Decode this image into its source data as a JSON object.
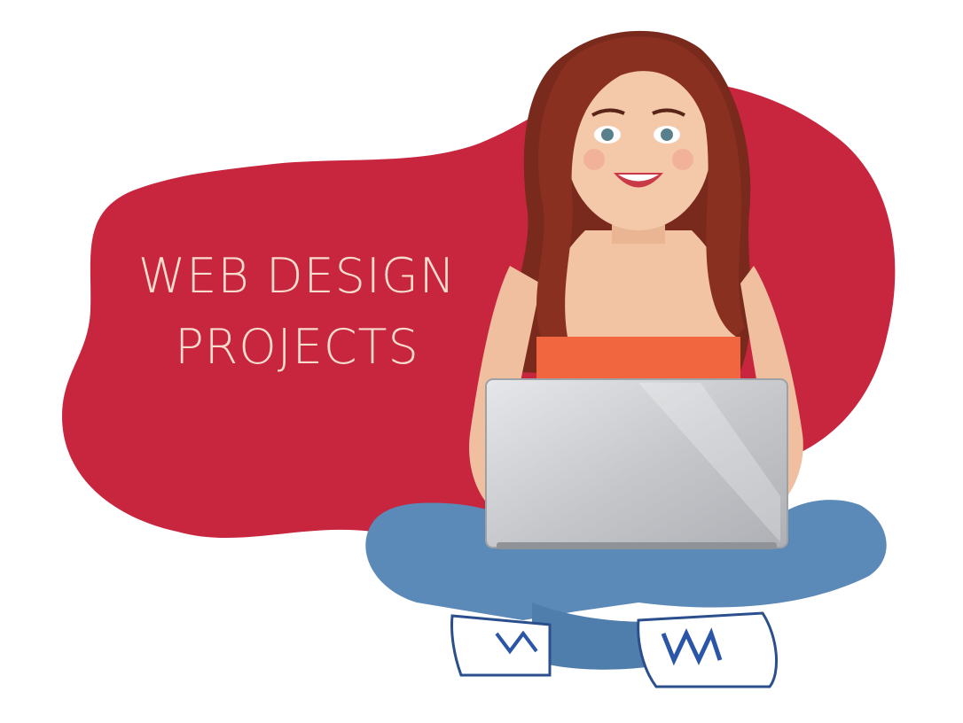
{
  "headline": {
    "line1": "WEB DESIGN",
    "line2": "PROJECTS"
  },
  "colors": {
    "background": "#ffffff",
    "blob": "#c8263f",
    "headline_text": "#f6dccd",
    "hair": "#7a2a1c",
    "skin": "#f2c4a4",
    "top": "#f2663f",
    "laptop": "#c9cbcf",
    "jeans": "#5b89b8",
    "shoe": "#ffffff",
    "laces": "#2a55a8"
  },
  "icons": [
    "red-blob-shape",
    "woman-with-laptop-illustration",
    "laptop-icon"
  ]
}
